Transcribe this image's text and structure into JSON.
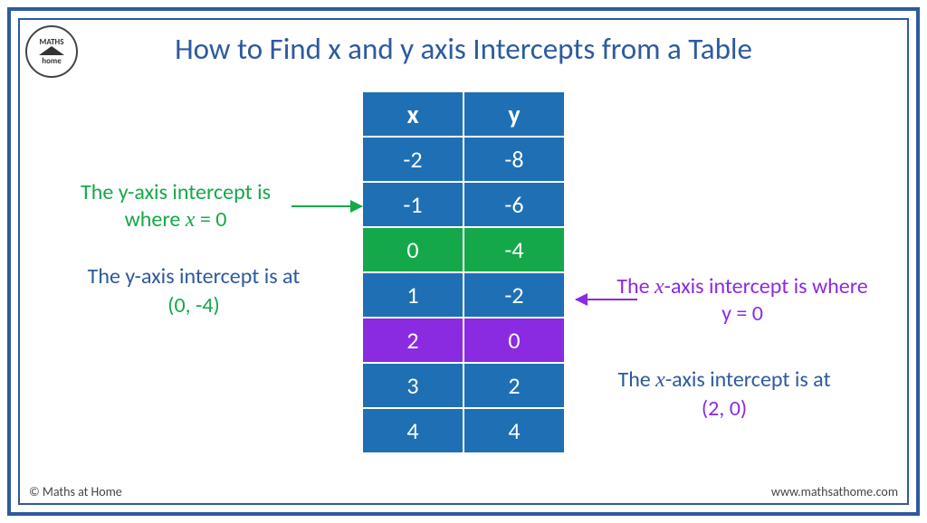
{
  "title": "How to Find x and y axis Intercepts from a Table",
  "logo": {
    "top": "MATHS",
    "bottom": "home"
  },
  "table": {
    "headers": {
      "x": "x",
      "y": "y"
    },
    "rows": [
      {
        "x": "-2",
        "y": "-8",
        "highlight": "none"
      },
      {
        "x": "-1",
        "y": "-6",
        "highlight": "none"
      },
      {
        "x": "0",
        "y": "-4",
        "highlight": "green"
      },
      {
        "x": "1",
        "y": "-2",
        "highlight": "none"
      },
      {
        "x": "2",
        "y": "0",
        "highlight": "purple"
      },
      {
        "x": "3",
        "y": "2",
        "highlight": "none"
      },
      {
        "x": "4",
        "y": "4",
        "highlight": "none"
      }
    ]
  },
  "annotations": {
    "y_intercept_where_pre": "The y-axis intercept is where ",
    "y_intercept_where_var": "x",
    "y_intercept_where_post": " = 0",
    "y_intercept_at": "The y-axis intercept is at",
    "y_intercept_coord": "(0, -4)",
    "x_intercept_where_pre": "The ",
    "x_intercept_where_var": "x",
    "x_intercept_where_post": "-axis intercept is where y = 0",
    "x_intercept_at_pre": "The ",
    "x_intercept_at_var": "x",
    "x_intercept_at_post": "-axis intercept is at",
    "x_intercept_coord": "(2, 0)"
  },
  "footer": {
    "copyright": "© Maths at Home",
    "url": "www.mathsathome.com"
  },
  "chart_data": {
    "type": "table",
    "columns": [
      "x",
      "y"
    ],
    "rows": [
      [
        -2,
        -8
      ],
      [
        -1,
        -6
      ],
      [
        0,
        -4
      ],
      [
        1,
        -2
      ],
      [
        2,
        0
      ],
      [
        3,
        2
      ],
      [
        4,
        4
      ]
    ],
    "y_intercept": [
      0,
      -4
    ],
    "x_intercept": [
      2,
      0
    ]
  }
}
